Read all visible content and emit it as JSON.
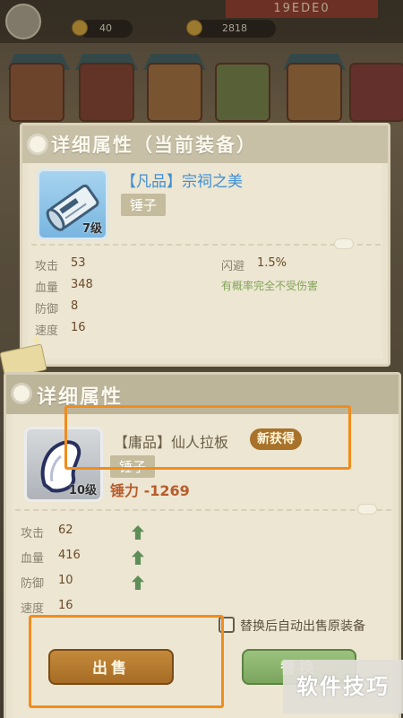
{
  "background": {
    "resource_left": "40",
    "resource_right": "2818",
    "banner": "19EDE0"
  },
  "current_panel": {
    "title": "详细属性（当前装备）",
    "item_name": "【凡品】宗祠之美",
    "level": "7级",
    "type_tag": "锤子",
    "stats": [
      {
        "label": "攻击",
        "value": "53"
      },
      {
        "label": "血量",
        "value": "348"
      },
      {
        "label": "防御",
        "value": "8"
      },
      {
        "label": "速度",
        "value": "16"
      }
    ],
    "dodge_label": "闪避",
    "dodge_value": "1.5%",
    "dodge_desc": "有概率完全不受伤害"
  },
  "new_panel": {
    "title": "详细属性",
    "item_name": "【庸品】仙人拉板",
    "new_badge": "新获得",
    "level": "10级",
    "type_tag": "锤子",
    "power": "锤力 -1269",
    "stats": [
      {
        "label": "攻击",
        "value": "62",
        "trend": "up"
      },
      {
        "label": "血量",
        "value": "416",
        "trend": "up"
      },
      {
        "label": "防御",
        "value": "10",
        "trend": "up"
      },
      {
        "label": "速度",
        "value": "16",
        "trend": "same"
      }
    ],
    "auto_sell_label": "替换后自动出售原装备",
    "sell_button": "出售",
    "replace_button": "替换"
  },
  "watermark": "软件技巧",
  "colors": {
    "highlight": "#f28c1c",
    "sell_button": "#b57a2f",
    "replace_button": "#8ab46d",
    "item_name_current": "#3f8fd3",
    "power": "#b85c2c"
  }
}
